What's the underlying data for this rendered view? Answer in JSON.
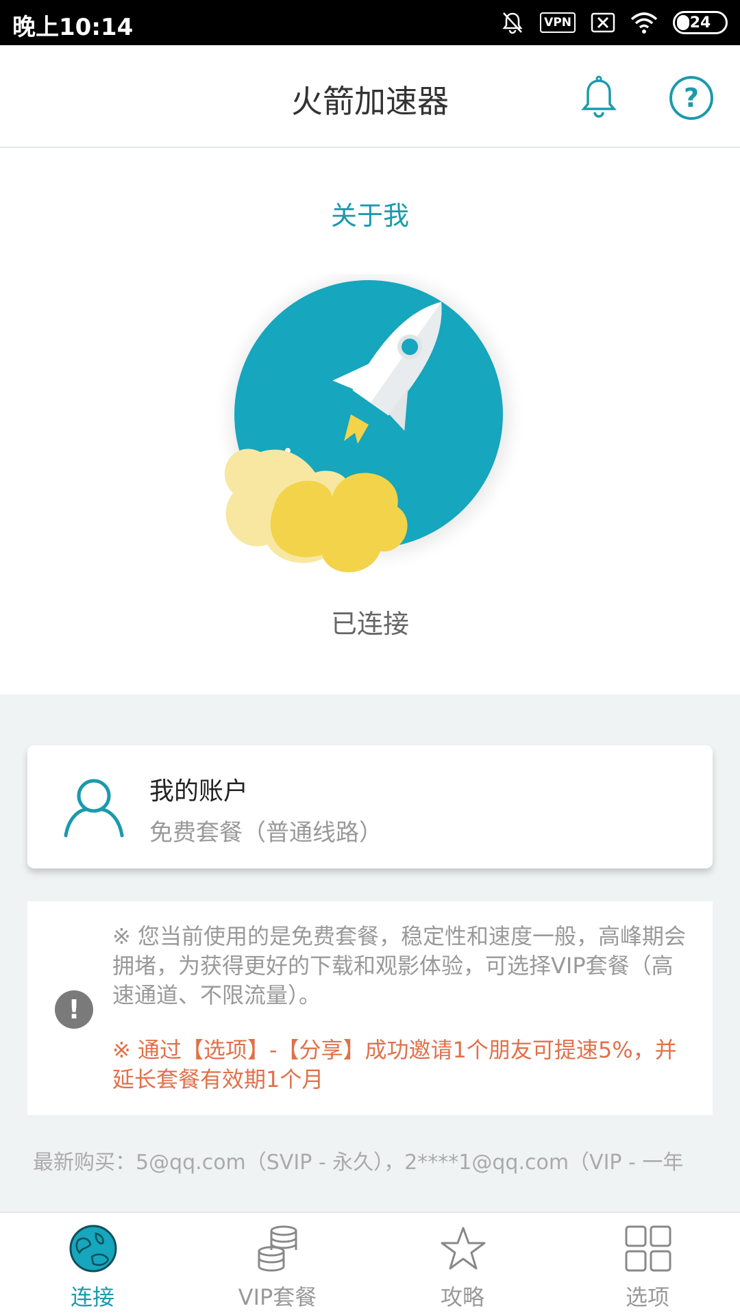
{
  "status_bar": {
    "time": "晚上10:14",
    "vpn_label": "VPN",
    "battery": "24"
  },
  "header": {
    "title": "火箭加速器",
    "bell_icon": "bell-icon",
    "help_icon": "help-icon",
    "help_glyph": "?"
  },
  "main": {
    "about_link": "关于我",
    "status": "已连接"
  },
  "account": {
    "title": "我的账户",
    "subtitle": "免费套餐（普通线路）"
  },
  "notice": {
    "icon_glyph": "!",
    "text1": "※ 您当前使用的是免费套餐，稳定性和速度一般，高峰期会拥堵，为获得更好的下载和观影体验，可选择VIP套餐（高速通道、不限流量）。",
    "text2": "※ 通过【选项】-【分享】成功邀请1个朋友可提速5%，并延长套餐有效期1个月"
  },
  "purchases": {
    "text": "最新购买：5@qq.com（SVIP - 永久），2****1@qq.com（VIP - 一年"
  },
  "nav": {
    "items": [
      {
        "label": "连接",
        "icon": "globe-icon",
        "active": true
      },
      {
        "label": "VIP套餐",
        "icon": "coins-icon",
        "active": false
      },
      {
        "label": "攻略",
        "icon": "star-icon",
        "active": false
      },
      {
        "label": "选项",
        "icon": "grid-icon",
        "active": false
      }
    ]
  },
  "colors": {
    "accent": "#1a9aac",
    "rocket_circle": "#16a6bd",
    "cloud_yellow": "#f2d34a",
    "notice_orange": "#e0714a",
    "gray_bg": "#f0f3f4"
  }
}
